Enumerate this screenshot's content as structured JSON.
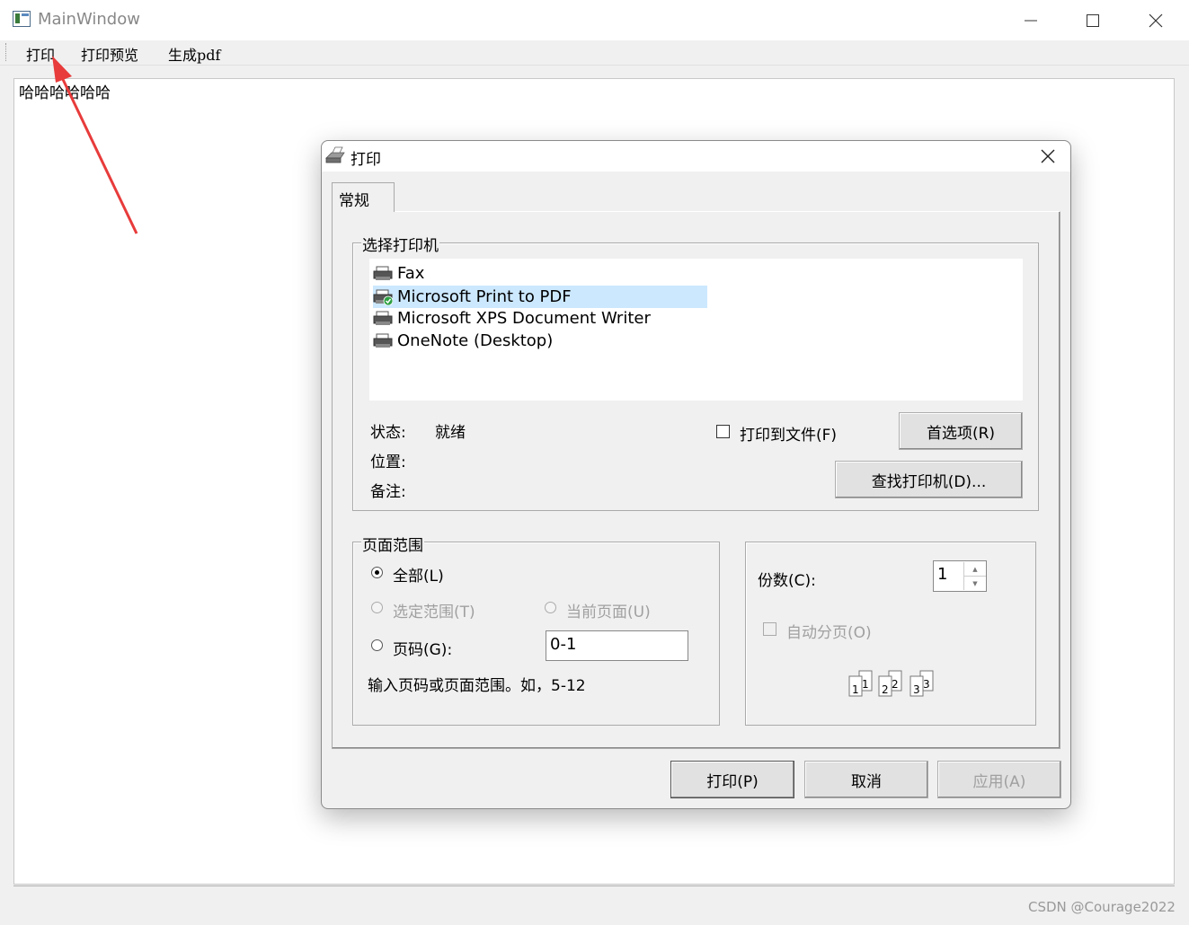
{
  "window": {
    "title": "MainWindow",
    "controls": {
      "minimize": "—",
      "maximize": "☐",
      "close": "✕"
    }
  },
  "menu": [
    {
      "label": "打印"
    },
    {
      "label": "打印预览"
    },
    {
      "label": "生成pdf"
    }
  ],
  "editor": {
    "text": "哈哈哈哈哈哈"
  },
  "watermark": "CSDN @Courage2022",
  "dialog": {
    "title": "打印",
    "close": "✕",
    "tab": "常规",
    "printer_group": {
      "label": "选择打印机",
      "printers": [
        {
          "name": "Fax",
          "selected": false,
          "default": false
        },
        {
          "name": "Microsoft Print to PDF",
          "selected": true,
          "default": true
        },
        {
          "name": "Microsoft XPS Document Writer",
          "selected": false,
          "default": false
        },
        {
          "name": "OneNote (Desktop)",
          "selected": false,
          "default": false
        }
      ],
      "status_label": "状态:",
      "status_value": "就绪",
      "location_label": "位置:",
      "comment_label": "备注:",
      "print_to_file": "打印到文件(F)",
      "preferences": "首选项(R)",
      "find_printer": "查找打印机(D)..."
    },
    "range_group": {
      "label": "页面范围",
      "all": "全部(L)",
      "selection": "选定范围(T)",
      "current_page": "当前页面(U)",
      "pages": "页码(G):",
      "pages_value": "0-1",
      "hint": "输入页码或页面范围。如，5-12",
      "selected": "all"
    },
    "copies_group": {
      "copies_label": "份数(C):",
      "copies_value": "1",
      "collate": "自动分页(O)"
    },
    "buttons": {
      "print": "打印(P)",
      "cancel": "取消",
      "apply": "应用(A)"
    }
  },
  "colors": {
    "selection": "#cce8ff",
    "arrow": "#e83b3b",
    "disabled_text": "#a0a0a0"
  }
}
